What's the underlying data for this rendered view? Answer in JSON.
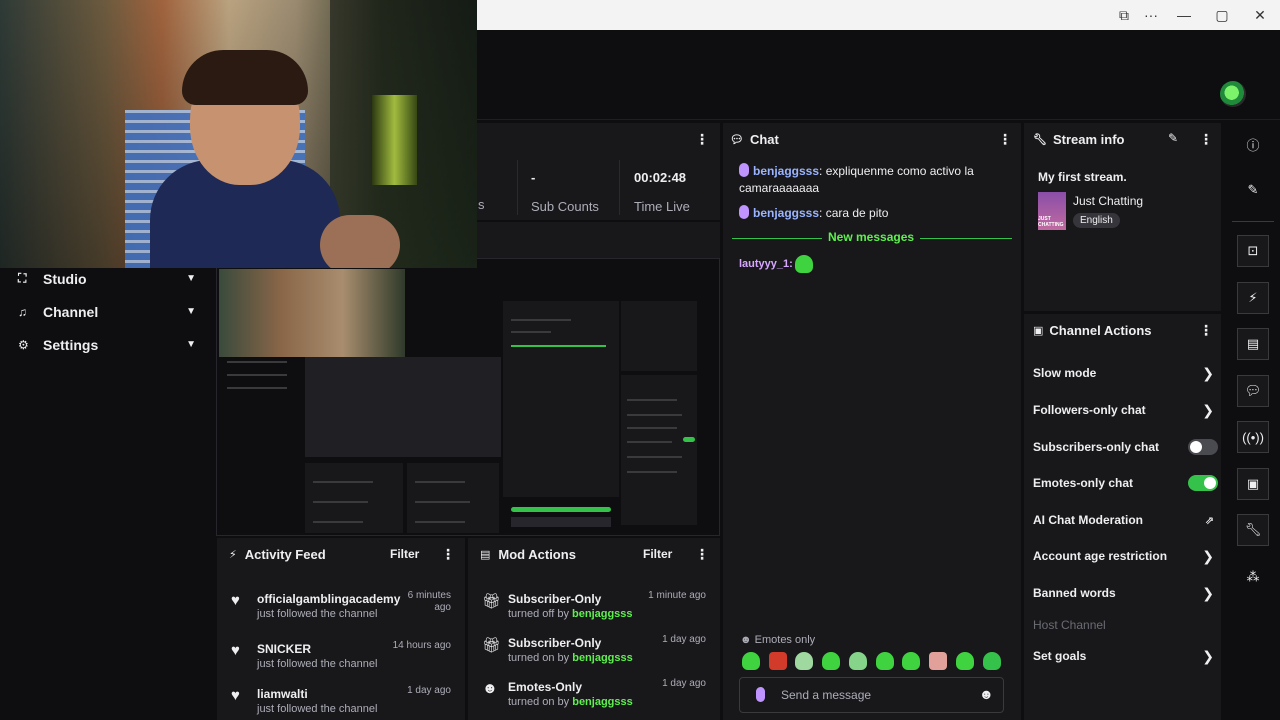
{
  "window": {
    "icons": [
      "snap-icon",
      "more-icon",
      "minimize-icon",
      "maximize-icon",
      "close-icon"
    ],
    "glyphs": [
      "⧉",
      "···",
      "—",
      "▢",
      "✕"
    ]
  },
  "nav": [
    {
      "label": "Studio",
      "icon": "studio-icon"
    },
    {
      "label": "Channel",
      "icon": "channel-icon"
    },
    {
      "label": "Settings",
      "icon": "gear-icon"
    }
  ],
  "stats": [
    {
      "value": "-",
      "label": "Sub Counts"
    },
    {
      "value": "00:02:48",
      "label": "Time Live"
    }
  ],
  "stats_partial_label": "s",
  "chat": {
    "title": "Chat",
    "messages": [
      {
        "user": "benjaggsss",
        "text": ": expliquenme como activo la camaraaaaaaa"
      },
      {
        "user": "benjaggsss",
        "text": ": cara de pito"
      }
    ],
    "new_messages_label": "New messages",
    "late_message_user": "lautyyy_1:",
    "emotes_only_label": "Emotes only",
    "input_placeholder": "Send a message"
  },
  "stream_info": {
    "title": "Stream info",
    "stream_title": "My first stream.",
    "category": "Just Chatting",
    "thumb_text": "JUST CHATTING",
    "language": "English"
  },
  "channel_actions": {
    "title": "Channel Actions",
    "items": [
      {
        "label": "Slow mode",
        "kind": "arrow"
      },
      {
        "label": "Followers-only chat",
        "kind": "arrow"
      },
      {
        "label": "Subscribers-only chat",
        "kind": "toggle",
        "on": false
      },
      {
        "label": "Emotes-only chat",
        "kind": "toggle",
        "on": true
      },
      {
        "label": "AI Chat Moderation",
        "kind": "external"
      },
      {
        "label": "Account age restriction",
        "kind": "arrow"
      },
      {
        "label": "Banned words",
        "kind": "arrow"
      },
      {
        "label": "Host Channel",
        "kind": "disabled"
      },
      {
        "label": "Set goals",
        "kind": "arrow"
      }
    ]
  },
  "activity_feed": {
    "title": "Activity Feed",
    "filter_label": "Filter",
    "items": [
      {
        "name": "officialgamblingacademy",
        "sub": "just followed the channel",
        "time": "6 minutes ago"
      },
      {
        "name": "SNICKER",
        "sub": "just followed the channel",
        "time": "14 hours ago"
      },
      {
        "name": "liamwalti",
        "sub": "just followed the channel",
        "time": "1 day ago"
      }
    ]
  },
  "mod_actions": {
    "title": "Mod Actions",
    "filter_label": "Filter",
    "items": [
      {
        "title": "Subscriber-Only",
        "action": "turned off by",
        "by": "benjaggsss",
        "time": "1 minute ago",
        "icon": "gift-icon"
      },
      {
        "title": "Subscriber-Only",
        "action": "turned on by",
        "by": "benjaggsss",
        "time": "1 day ago",
        "icon": "gift-icon"
      },
      {
        "title": "Emotes-Only",
        "action": "turned on by",
        "by": "benjaggsss",
        "time": "1 day ago",
        "icon": "emote-icon"
      }
    ]
  },
  "colors": {
    "accent": "#5ef04f",
    "background": "#0e0e10",
    "panel": "#18181b",
    "username": "#9ab4ff"
  }
}
